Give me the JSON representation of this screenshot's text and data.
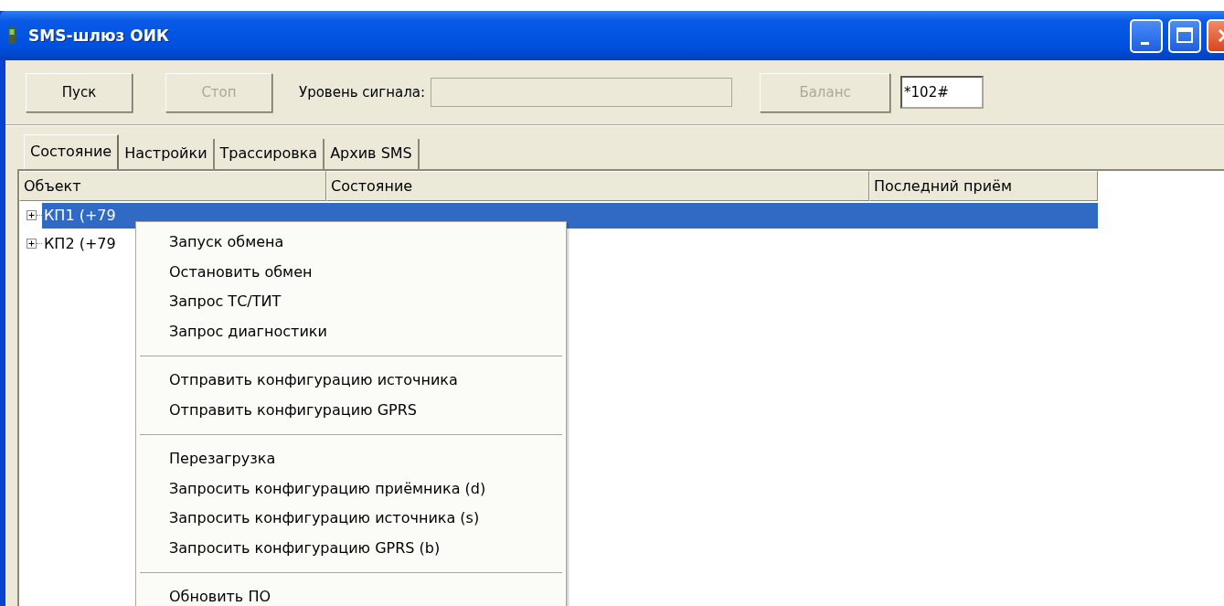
{
  "window": {
    "title": "SMS-шлюз ОИК"
  },
  "toolbar": {
    "start_button": {
      "label": "Пуск",
      "disabled": false
    },
    "stop_button": {
      "label": "Стоп",
      "disabled": true
    },
    "signal_label": "Уровень сигнала:",
    "balance_button": {
      "label": "Баланс",
      "disabled": true
    },
    "ussd_field": {
      "value": "*102#"
    }
  },
  "tabs": [
    {
      "label": "Состояние",
      "selected": true
    },
    {
      "label": "Настройки",
      "selected": false
    },
    {
      "label": "Трассировка",
      "selected": false
    },
    {
      "label": "Архив SMS",
      "selected": false
    }
  ],
  "table": {
    "columns": [
      "Объект",
      "Состояние",
      "Последний приём"
    ],
    "rows": [
      {
        "object": "КП1 (+79",
        "selected": true,
        "expanded": false
      },
      {
        "object": "КП2 (+79",
        "selected": false,
        "expanded": false
      }
    ]
  },
  "context_menu": {
    "items": [
      {
        "kind": "item",
        "label": "Запуск обмена"
      },
      {
        "kind": "item",
        "label": "Остановить обмен"
      },
      {
        "kind": "item",
        "label": "Запрос ТС/ТИТ"
      },
      {
        "kind": "item",
        "label": "Запрос диагностики"
      },
      {
        "kind": "separator"
      },
      {
        "kind": "item",
        "label": "Отправить конфигурацию источника"
      },
      {
        "kind": "item",
        "label": "Отправить конфигурацию GPRS"
      },
      {
        "kind": "separator"
      },
      {
        "kind": "item",
        "label": "Перезагрузка"
      },
      {
        "kind": "item",
        "label": "Запросить конфигурацию приёмника (d)"
      },
      {
        "kind": "item",
        "label": "Запросить конфигурацию источника (s)"
      },
      {
        "kind": "item",
        "label": "Запросить конфигурацию GPRS (b)"
      },
      {
        "kind": "separator"
      },
      {
        "kind": "item",
        "label": "Обновить ПО"
      }
    ]
  }
}
